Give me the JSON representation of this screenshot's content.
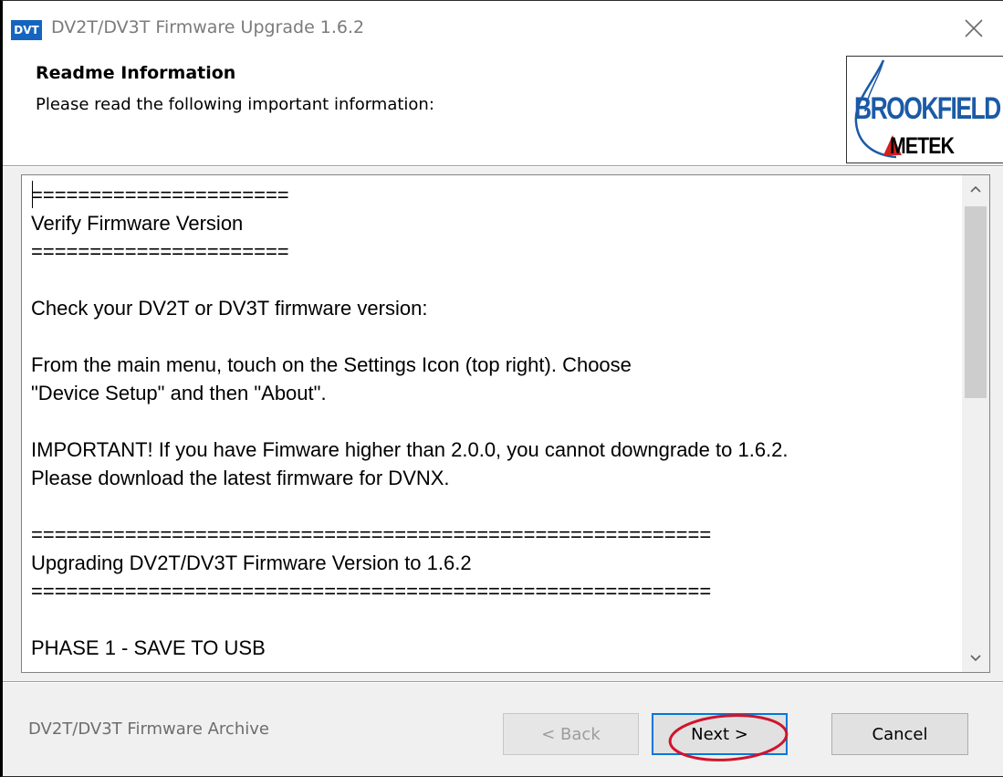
{
  "window": {
    "icon_text": "DVT",
    "title": "DV2T/DV3T Firmware Upgrade 1.6.2"
  },
  "header": {
    "title": "Readme Information",
    "subtitle": "Please read the following important information:",
    "logo_text_1": "BROOKFIELD",
    "logo_text_2": "METEK"
  },
  "readme": {
    "lines": [
      "======================",
      "Verify Firmware Version",
      "======================",
      "",
      "Check your DV2T or DV3T firmware version:",
      "",
      "From the main menu, touch on the Settings Icon (top right). Choose",
      "\"Device Setup\" and then \"About\".",
      "",
      "IMPORTANT! If you have Fimware higher than 2.0.0, you cannot downgrade to 1.6.2.",
      "Please download the latest firmware for DVNX.",
      "",
      "==========================================================",
      "Upgrading DV2T/DV3T Firmware Version to 1.6.2",
      "==========================================================",
      "",
      "PHASE 1 - SAVE TO USB"
    ]
  },
  "footer": {
    "label": "DV2T/DV3T Firmware Archive",
    "back_label": "< Back",
    "next_label": "Next >",
    "cancel_label": "Cancel"
  },
  "colors": {
    "accent": "#0078d7",
    "highlight": "#d0142c",
    "logo_blue": "#1b5aa6"
  }
}
